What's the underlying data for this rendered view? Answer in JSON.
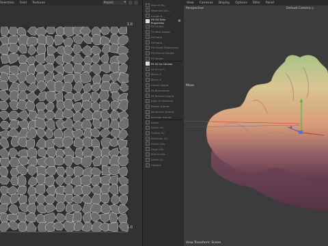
{
  "uv_menu": [
    "Selection",
    "Field",
    "Textures"
  ],
  "uv_dropdown": "Project",
  "uv_corner_top": "1.0",
  "uv_corner_bottom": "1.0",
  "mid_rows": [
    {
      "label": "Search Pa...",
      "checked": false
    },
    {
      "label": "Reserved Ass...",
      "checked": false
    },
    {
      "label": "Assign A...",
      "checked": false
    },
    {
      "label": "Fill UV Sets Properties",
      "checked": true,
      "gear": true
    },
    {
      "label": "Fill Unfold",
      "checked": false
    },
    {
      "label": "Fill Best Nodes",
      "checked": false
    },
    {
      "label": "Fill Ratio",
      "checked": false
    },
    {
      "label": "Fill Ratio",
      "checked": false
    },
    {
      "label": "Fill Smart Proportions",
      "checked": false
    },
    {
      "label": "Fill Manual Border",
      "checked": false
    },
    {
      "label": "Fill Nodes",
      "checked": false
    },
    {
      "label": "Fit UV to Canvas",
      "checked": true
    },
    {
      "label": "Fit UV to P...",
      "checked": false
    },
    {
      "label": "Mirror U",
      "checked": false
    },
    {
      "label": "Mirror V",
      "checked": false
    },
    {
      "label": "Center Island",
      "checked": false
    },
    {
      "label": "Fit Boundaries",
      "checked": false
    },
    {
      "label": "Fit Relaxed Island",
      "checked": false
    },
    {
      "label": "Align to Selected",
      "checked": false
    },
    {
      "label": "Rotate Islands",
      "checked": false
    },
    {
      "label": "Normalize Islands",
      "checked": false
    },
    {
      "label": "Average Islands",
      "checked": false
    },
    {
      "label": "Select",
      "checked": false
    },
    {
      "label": "Select UV",
      "checked": false
    },
    {
      "label": "Flatten UV",
      "checked": false
    },
    {
      "label": "Selection UV",
      "checked": false
    },
    {
      "label": "Select UVs",
      "checked": false
    },
    {
      "label": "Grow UVs",
      "checked": false
    },
    {
      "label": "Shrink UVs",
      "checked": false
    },
    {
      "label": "Select All",
      "checked": false
    },
    {
      "label": "Options",
      "checked": false
    }
  ],
  "vp_menu": [
    "View",
    "Cameras",
    "Display",
    "Options",
    "Filter",
    "Panel"
  ],
  "vp_perspective": "Perspective",
  "vp_camera": "Default Camera ▷",
  "vp_move_label": "Move",
  "vp_bottom_label": "View Transform: Scene",
  "colors": {
    "uv_edge": "#e8e8e8",
    "uv_island": "#6e6e6e",
    "x_axis": "#d43030",
    "y_axis": "#30c030",
    "z_axis": "#3060e0"
  }
}
